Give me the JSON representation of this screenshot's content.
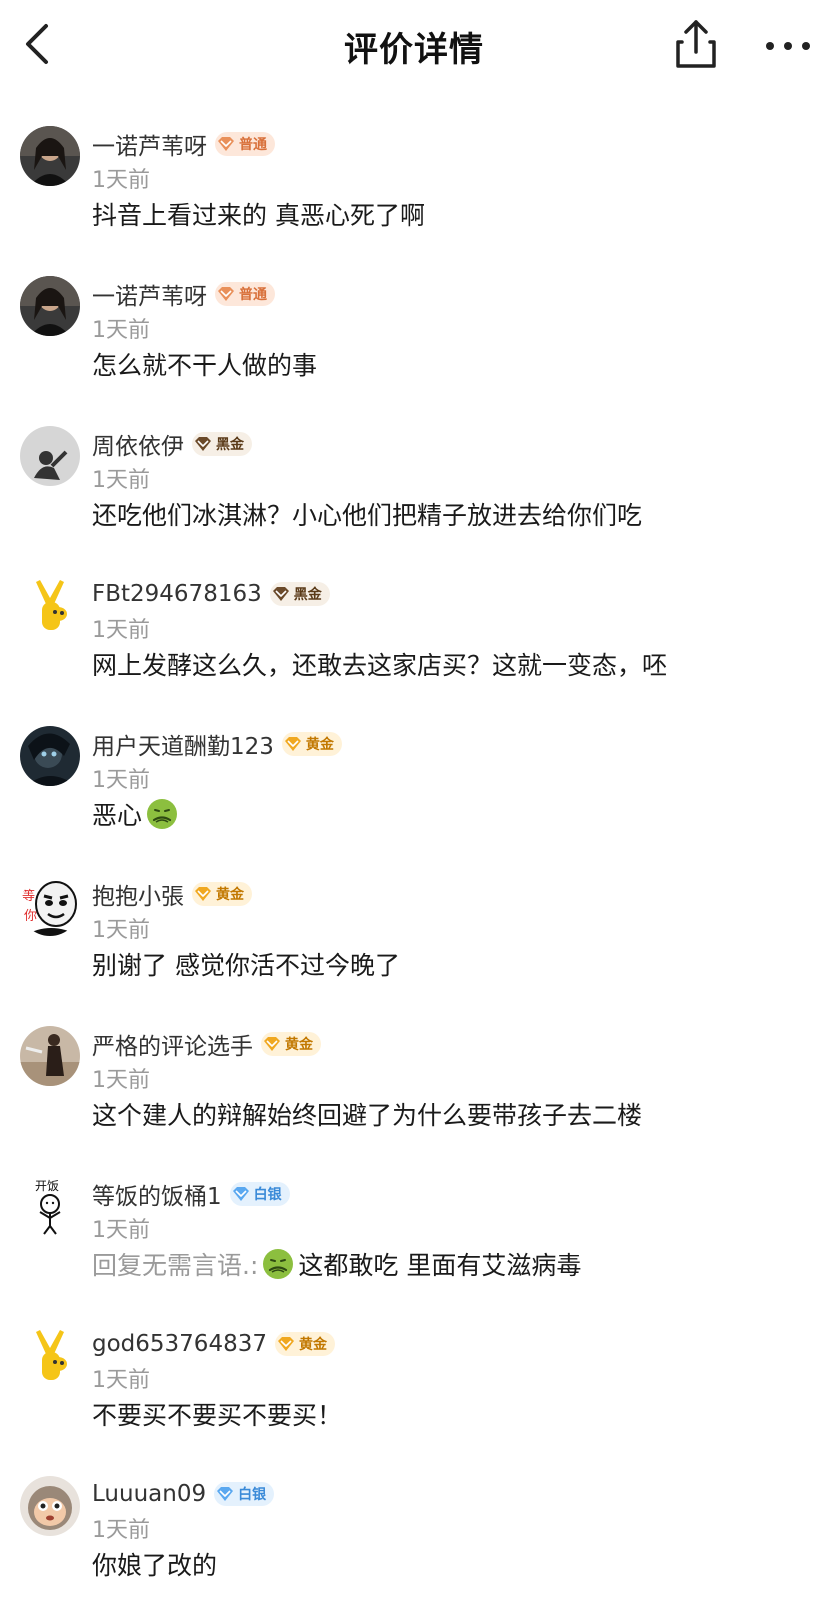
{
  "header": {
    "title": "评价详情"
  },
  "colors": {
    "badge_bronze": "#e9905a",
    "badge_black_gold": "#7a4a1a",
    "badge_gold": "#f0a020",
    "badge_silver": "#4a9ee0",
    "muted_text": "#9a9a9a"
  },
  "comments": [
    {
      "username": "一诺芦苇呀",
      "badge": "普通",
      "badge_type": "bronze",
      "time": "1天前",
      "text": "抖音上看过来的 真恶心死了啊",
      "avatar": "photo-woman-dark"
    },
    {
      "username": "一诺芦苇呀",
      "badge": "普通",
      "badge_type": "bronze",
      "time": "1天前",
      "text": "怎么就不干人做的事",
      "avatar": "photo-woman-dark"
    },
    {
      "username": "周依依伊",
      "badge": "黑金",
      "badge_type": "black-gold",
      "time": "1天前",
      "text": "还吃他们冰淇淋？小心他们把精子放进去给你们吃",
      "avatar": "silhouette-grey"
    },
    {
      "username": "FBt294678163",
      "badge": "黑金",
      "badge_type": "black-gold",
      "time": "1天前",
      "text": "网上发酵这么久，还敢去这家店买？这就一变态，呸",
      "avatar": "yellow-mascot"
    },
    {
      "username": "用户天道酬勤123",
      "badge": "黄金",
      "badge_type": "gold",
      "time": "1天前",
      "text": "恶心",
      "emoji_after": "nauseated-face",
      "avatar": "dark-anime"
    },
    {
      "username": "抱抱小張",
      "badge": "黄金",
      "badge_type": "gold",
      "time": "1天前",
      "text": "别谢了 感觉你活不过今晚了",
      "avatar": "meme-face"
    },
    {
      "username": "严格的评论选手",
      "badge": "黄金",
      "badge_type": "gold",
      "time": "1天前",
      "text": "这个建人的辩解始终回避了为什么要带孩子去二楼",
      "avatar": "photo-figure"
    },
    {
      "username": "等饭的饭桶1",
      "badge": "白银",
      "badge_type": "silver",
      "time": "1天前",
      "reply_prefix": "回复无需言语.:",
      "text": "这都敢吃 里面有艾滋病毒",
      "emoji_before": "nauseated-face",
      "avatar": "stick-figure",
      "avatar_text": "开饭"
    },
    {
      "username": "god653764837",
      "badge": "黄金",
      "badge_type": "gold",
      "time": "1天前",
      "text": "不要买不要买不要买！",
      "avatar": "yellow-mascot"
    },
    {
      "username": "Luuuan09",
      "badge": "白银",
      "badge_type": "silver",
      "time": "1天前",
      "text": "你娘了改的",
      "avatar": "monkey-face"
    }
  ]
}
